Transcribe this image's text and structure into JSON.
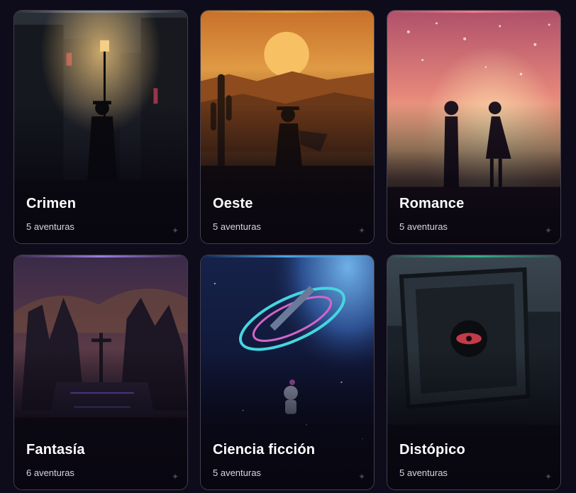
{
  "genres": [
    {
      "title": "Crimen",
      "count": "5 aventuras",
      "accent": "#8a8f99",
      "icon": "detective-noir-illustration"
    },
    {
      "title": "Oeste",
      "count": "5 aventuras",
      "accent": "#e2a03a",
      "icon": "cowboy-desert-illustration"
    },
    {
      "title": "Romance",
      "count": "5 aventuras",
      "accent": "#f07a8a",
      "icon": "couple-sunset-illustration"
    },
    {
      "title": "Fantasía",
      "count": "6 aventuras",
      "accent": "#9a7ee0",
      "icon": "sword-altar-illustration"
    },
    {
      "title": "Ciencia ficción",
      "count": "5 aventuras",
      "accent": "#49a6e6",
      "icon": "space-station-illustration"
    },
    {
      "title": "Distópico",
      "count": "5 aventuras",
      "accent": "#2fb38a",
      "icon": "surveillance-screen-illustration"
    }
  ]
}
